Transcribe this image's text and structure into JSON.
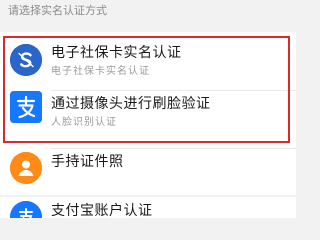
{
  "prompt_text": "请选择实名认证方式",
  "options": [
    {
      "title": "电子社保卡实名认证",
      "subtitle": "电子社保卡实名认证",
      "icon": "social-security-card-icon"
    },
    {
      "title": "通过摄像头进行刷脸验证",
      "subtitle": "人脸识别认证",
      "icon": "alipay-icon"
    },
    {
      "title": "手持证件照",
      "icon": "id-photo-icon"
    },
    {
      "title": "支付宝账户认证",
      "icon": "alipay-account-icon"
    }
  ],
  "colors": {
    "highlight": "#d92b2b",
    "social_icon": "#2a66c9",
    "alipay_blue": "#1677ff",
    "orange": "#ff8a18"
  }
}
